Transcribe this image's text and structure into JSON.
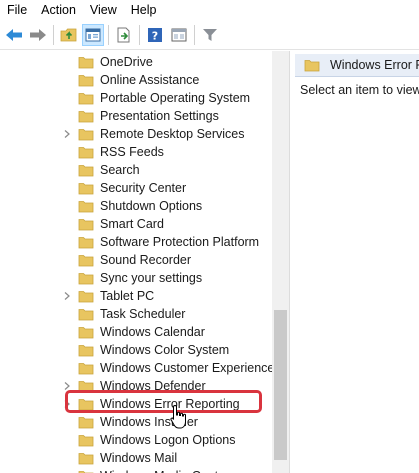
{
  "menu": [
    "File",
    "Action",
    "View",
    "Help"
  ],
  "toolbar": {
    "icons": [
      "back-arrow-icon",
      "forward-arrow-icon",
      "folder-up-icon",
      "show-hide-tree-icon",
      "export-list-icon",
      "help-icon",
      "properties-icon",
      "filter-icon"
    ]
  },
  "tree": {
    "items": [
      {
        "label": "OneDrive",
        "expandable": false
      },
      {
        "label": "Online Assistance",
        "expandable": false
      },
      {
        "label": "Portable Operating System",
        "expandable": false
      },
      {
        "label": "Presentation Settings",
        "expandable": false
      },
      {
        "label": "Remote Desktop Services",
        "expandable": true
      },
      {
        "label": "RSS Feeds",
        "expandable": false
      },
      {
        "label": "Search",
        "expandable": false
      },
      {
        "label": "Security Center",
        "expandable": false
      },
      {
        "label": "Shutdown Options",
        "expandable": false
      },
      {
        "label": "Smart Card",
        "expandable": false
      },
      {
        "label": "Software Protection Platform",
        "expandable": false
      },
      {
        "label": "Sound Recorder",
        "expandable": false
      },
      {
        "label": "Sync your settings",
        "expandable": false
      },
      {
        "label": "Tablet PC",
        "expandable": true
      },
      {
        "label": "Task Scheduler",
        "expandable": false
      },
      {
        "label": "Windows Calendar",
        "expandable": false
      },
      {
        "label": "Windows Color System",
        "expandable": false
      },
      {
        "label": "Windows Customer Experience Ir",
        "expandable": false
      },
      {
        "label": "Windows Defender",
        "expandable": true
      },
      {
        "label": "Windows Error Reporting",
        "expandable": true
      },
      {
        "label": "Windows Installer",
        "expandable": false
      },
      {
        "label": "Windows Logon Options",
        "expandable": false
      },
      {
        "label": "Windows Mail",
        "expandable": false
      },
      {
        "label": "Windows Media Center",
        "expandable": false
      }
    ]
  },
  "right_pane": {
    "title": "Windows Error Rep",
    "message": "Select an item to view"
  },
  "colors": {
    "highlight": "#d9343e",
    "folder": "#e8c560",
    "selected_header": "#e8eef7"
  }
}
